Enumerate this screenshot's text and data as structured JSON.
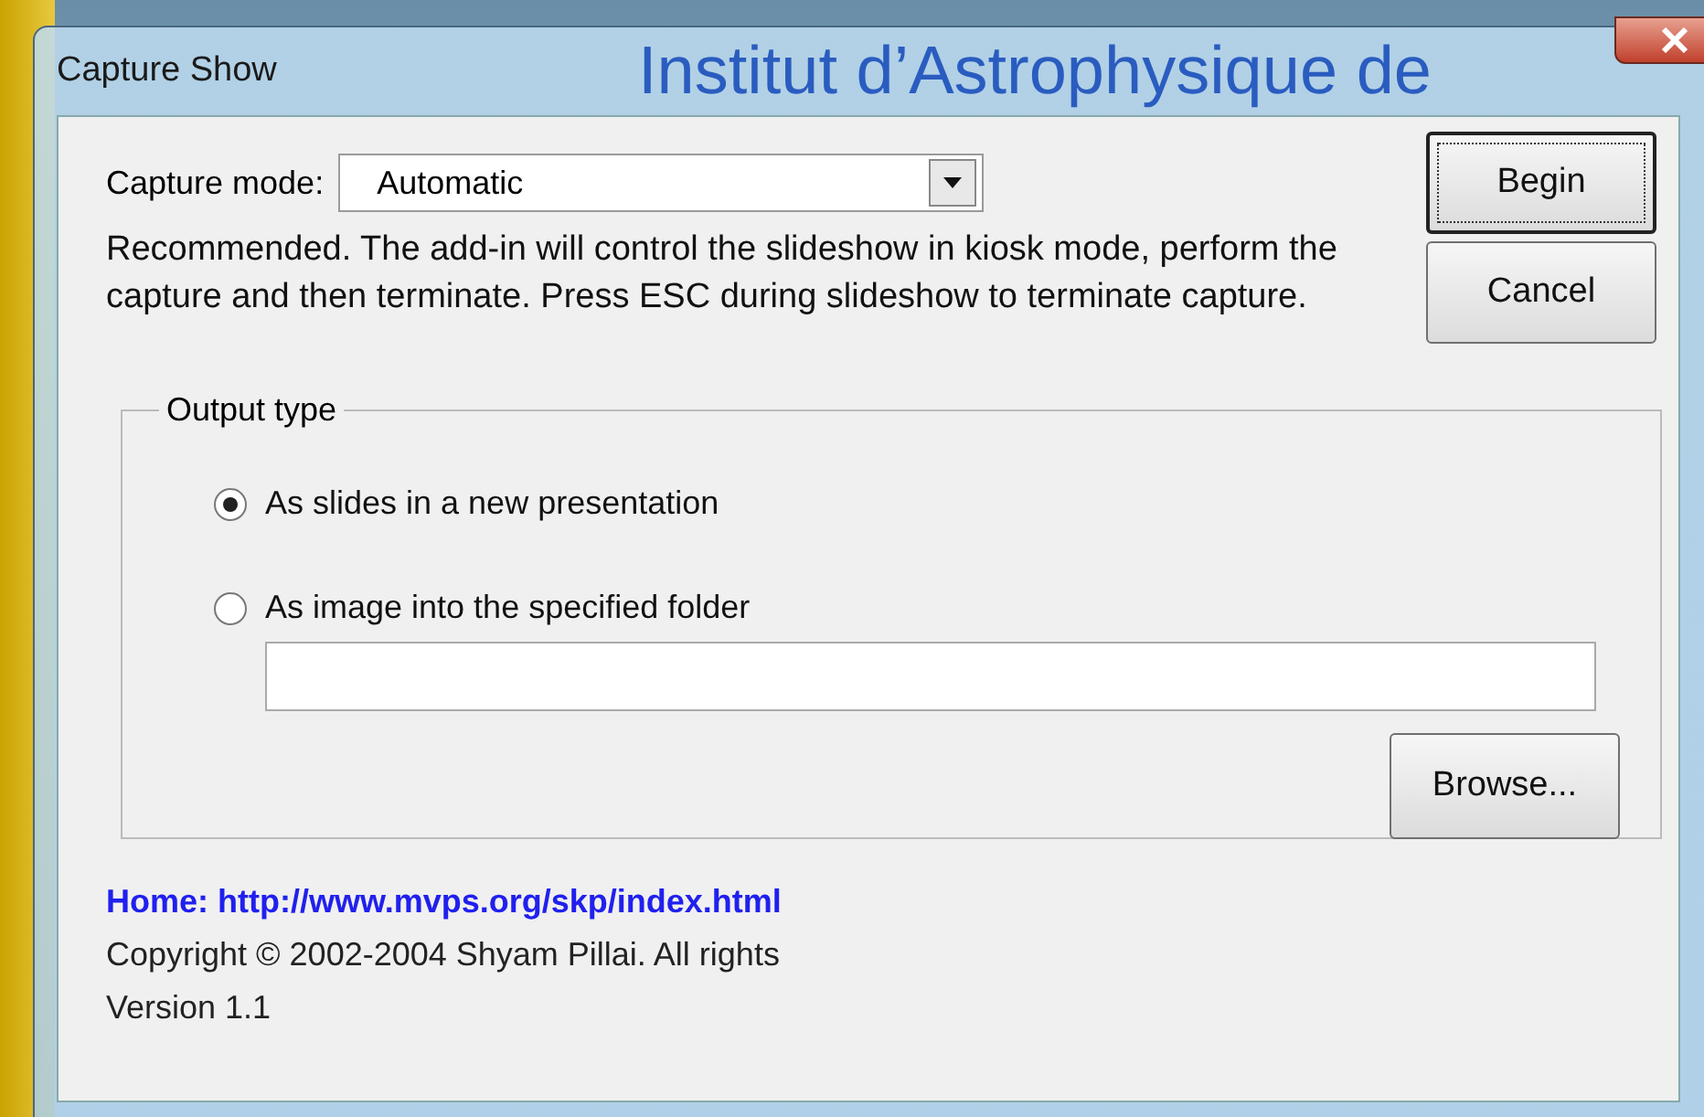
{
  "window": {
    "title": "Capture Show",
    "background_title": "Institut d’Astrophysique de"
  },
  "capture_mode": {
    "label": "Capture mode:",
    "value": "Automatic"
  },
  "description": "Recommended. The add-in will control the slideshow in kiosk mode, perform the capture and then terminate. Press ESC during slideshow to terminate capture.",
  "buttons": [
    {
      "label": "Begin",
      "default": true
    },
    {
      "label": "Cancel",
      "default": false
    }
  ],
  "output_type": {
    "title": "Output type",
    "options": [
      {
        "label": "As slides in a new presentation",
        "selected": true
      },
      {
        "label": "As image into the specified folder",
        "selected": false
      }
    ],
    "browse": "Browse..."
  },
  "home_link": "Home: http://www.mvps.org/skp/index.html",
  "copyright": "Copyright © 2002-2004 Shyam Pillai. All rights",
  "version": "Version 1.1"
}
